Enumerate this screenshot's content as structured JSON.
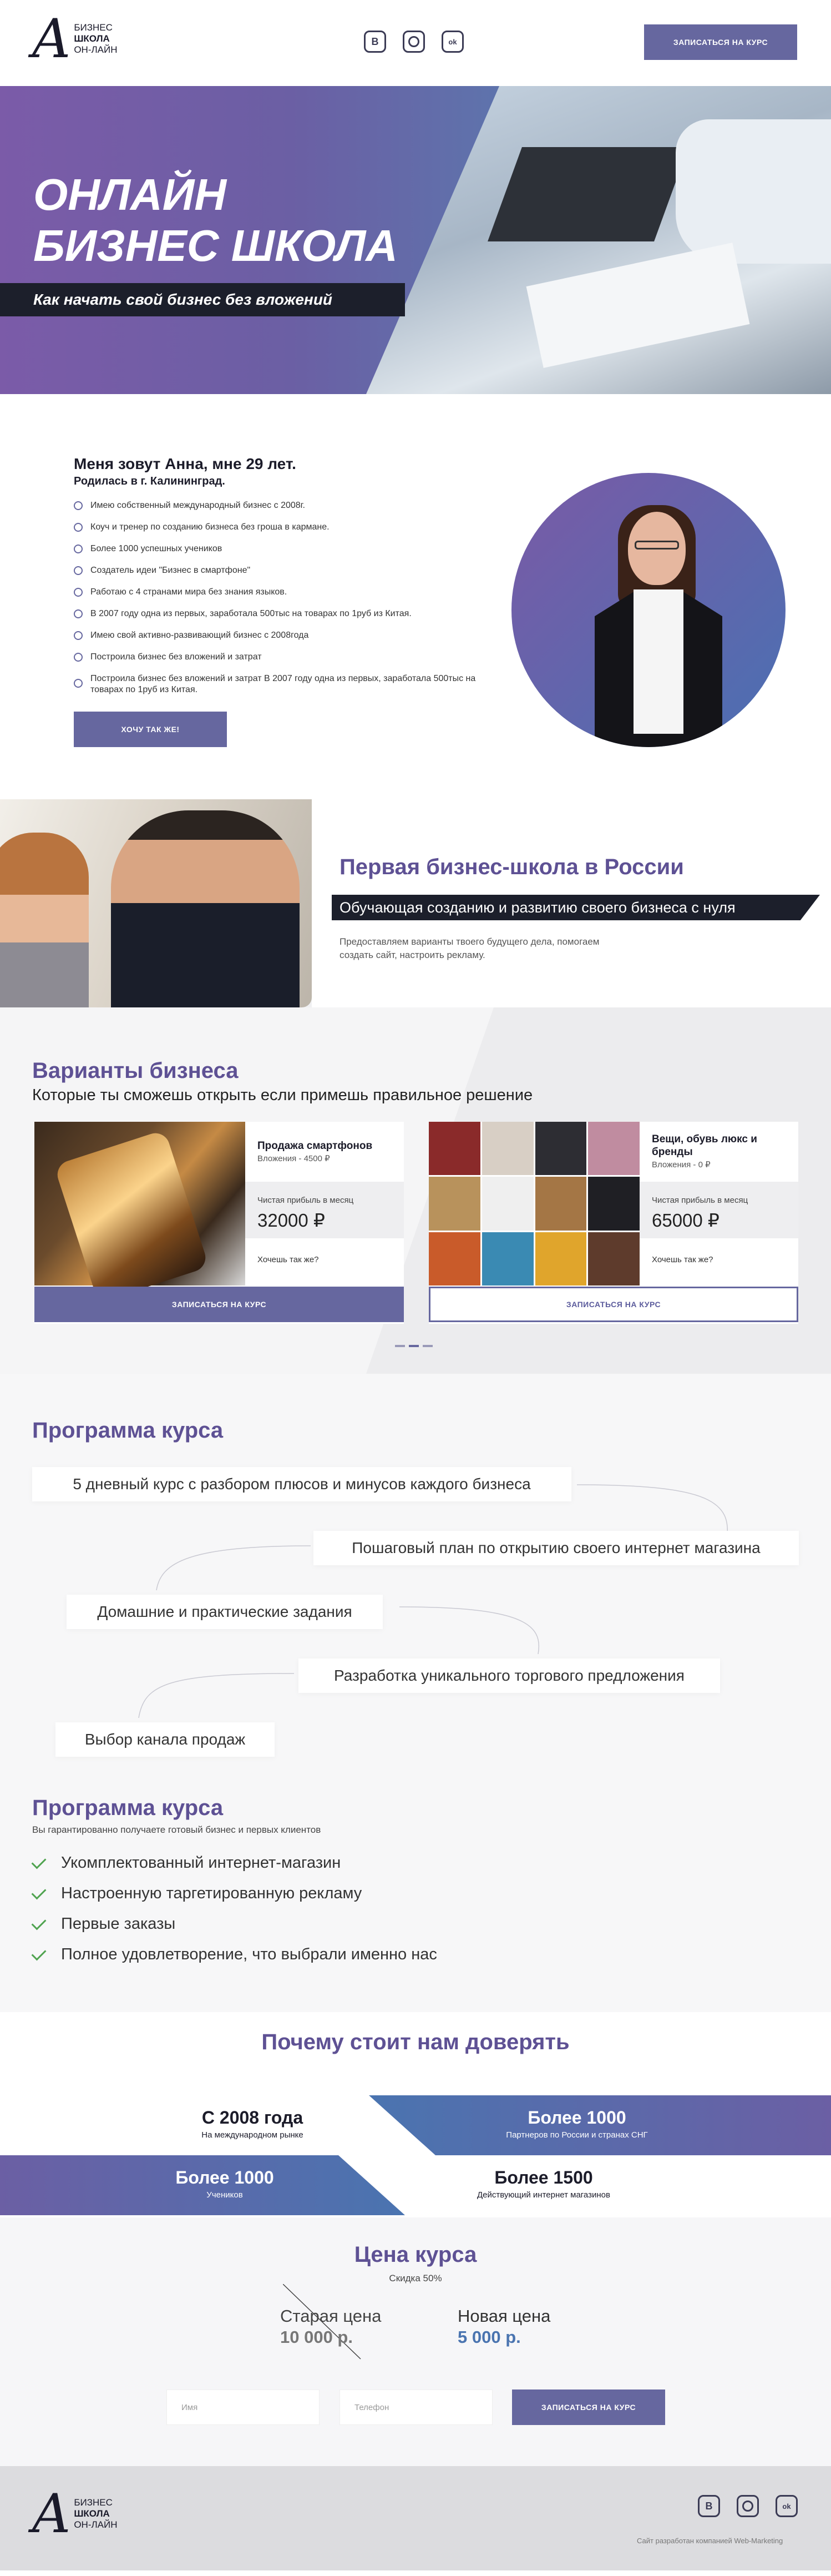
{
  "header": {
    "logo_mark": "A",
    "logo_lines": [
      "Бизнес",
      "школа",
      "он-лайн"
    ],
    "social": [
      {
        "name": "vk-icon",
        "glyph": "B"
      },
      {
        "name": "instagram-icon",
        "glyph": ""
      },
      {
        "name": "odnoklassniki-icon",
        "glyph": "ok"
      }
    ],
    "cta_label": "ЗАПИСАТЬСЯ НА КУРС"
  },
  "hero": {
    "title_line1": "ОНЛАЙН",
    "title_line2": "БИЗНЕС ШКОЛА",
    "tagline": "Как начать свой бизнес без вложений"
  },
  "about": {
    "heading": "Меня зовут Анна, мне 29 лет.",
    "subheading": "Родилась в г. Калининград.",
    "items": [
      "Имею собственный международный бизнес с 2008г.",
      "Коуч и тренер по созданию бизнеса без гроша в кармане.",
      "Более 1000 успешных учеников",
      "Создатель идеи \"Бизнес в смартфоне\"",
      "Работаю с 4 странами мира без знания языков.",
      "В 2007 году одна из первых, заработала 500тыс на товарах по 1руб из Китая.",
      "Имею свой активно-развивающий бизнес с 2008года",
      "Построила бизнес без вложений и затрат",
      "Построила бизнес без вложений и затрат В 2007 году одна из первых, заработала 500тыс на товарах по 1руб из Китая."
    ],
    "button_label": "ХОЧУ ТАК ЖЕ!"
  },
  "first_school": {
    "title": "Первая бизнес-школа в России",
    "banner": "Обучающая созданию и развитию своего бизнеса с нуля",
    "description": "Предоставляем варианты твоего будущего дела, помогаем создать сайт, настроить рекламу."
  },
  "variants": {
    "title": "Варианты бизнеса",
    "subtitle": "Которые ты сможешь открыть если примешь правильное решение",
    "cards": [
      {
        "name": "Продажа смартфонов",
        "investment": "Вложения - 4500 ₽",
        "profit_label": "Чистая прибыль в месяц",
        "profit_value": "32000 ₽",
        "want_label": "Хочешь так же?",
        "button_label": "ЗАПИСАТЬСЯ НА КУРС"
      },
      {
        "name": "Вещи, обувь люкс и бренды",
        "investment": "Вложения - 0 ₽",
        "profit_label": "Чистая прибыль в месяц",
        "profit_value": "65000 ₽",
        "want_label": "Хочешь так же?",
        "button_label": "ЗАПИСАТЬСЯ НА КУРС"
      }
    ],
    "slider_active": 1,
    "slider_count": 3
  },
  "program": {
    "title": "Программа курса",
    "steps": [
      "5 дневный курс с разбором плюсов и минусов каждого бизнеса",
      "Пошаговый план по открытию своего интернет магазина",
      "Домашние и практические задания",
      "Разработка уникального торгового предложения",
      "Выбор канала продаж"
    ],
    "result_title": "Программа курса",
    "result_subtitle": "Вы гарантированно получаете готовый бизнес и первых клиентов",
    "results": [
      "Укомплектованный интернет-магазин",
      "Настроенную таргетированную рекламу",
      "Первые заказы",
      "Полное удовлетворение, что выбрали именно нас"
    ]
  },
  "trust": {
    "title": "Почему стоит нам доверять",
    "stats": [
      {
        "value": "С 2008 года",
        "label": "На международном рынке"
      },
      {
        "value": "Более 1000",
        "label": "Партнеров по России и странах СНГ"
      },
      {
        "value": "Более 1000",
        "label": "Учеников"
      },
      {
        "value": "Более 1500",
        "label": "Действующий интернет магазинов"
      }
    ]
  },
  "price": {
    "title": "Цена курса",
    "discount": "Скидка 50%",
    "old_label": "Старая цена",
    "old_value": "10 000 р.",
    "new_label": "Новая цена",
    "new_value": "5 000 р.",
    "name_placeholder": "Имя",
    "phone_placeholder": "Телефон",
    "button_label": "ЗАПИСАТЬСЯ НА КУРС"
  },
  "footer": {
    "credits": "Сайт разработан компанией Web-Marketing"
  },
  "colors": {
    "accent": "#66679f",
    "title": "#5e5194",
    "dark_band": "#1c1f2b",
    "gradient_start": "#7b5ba8",
    "gradient_end": "#4a74b0"
  }
}
